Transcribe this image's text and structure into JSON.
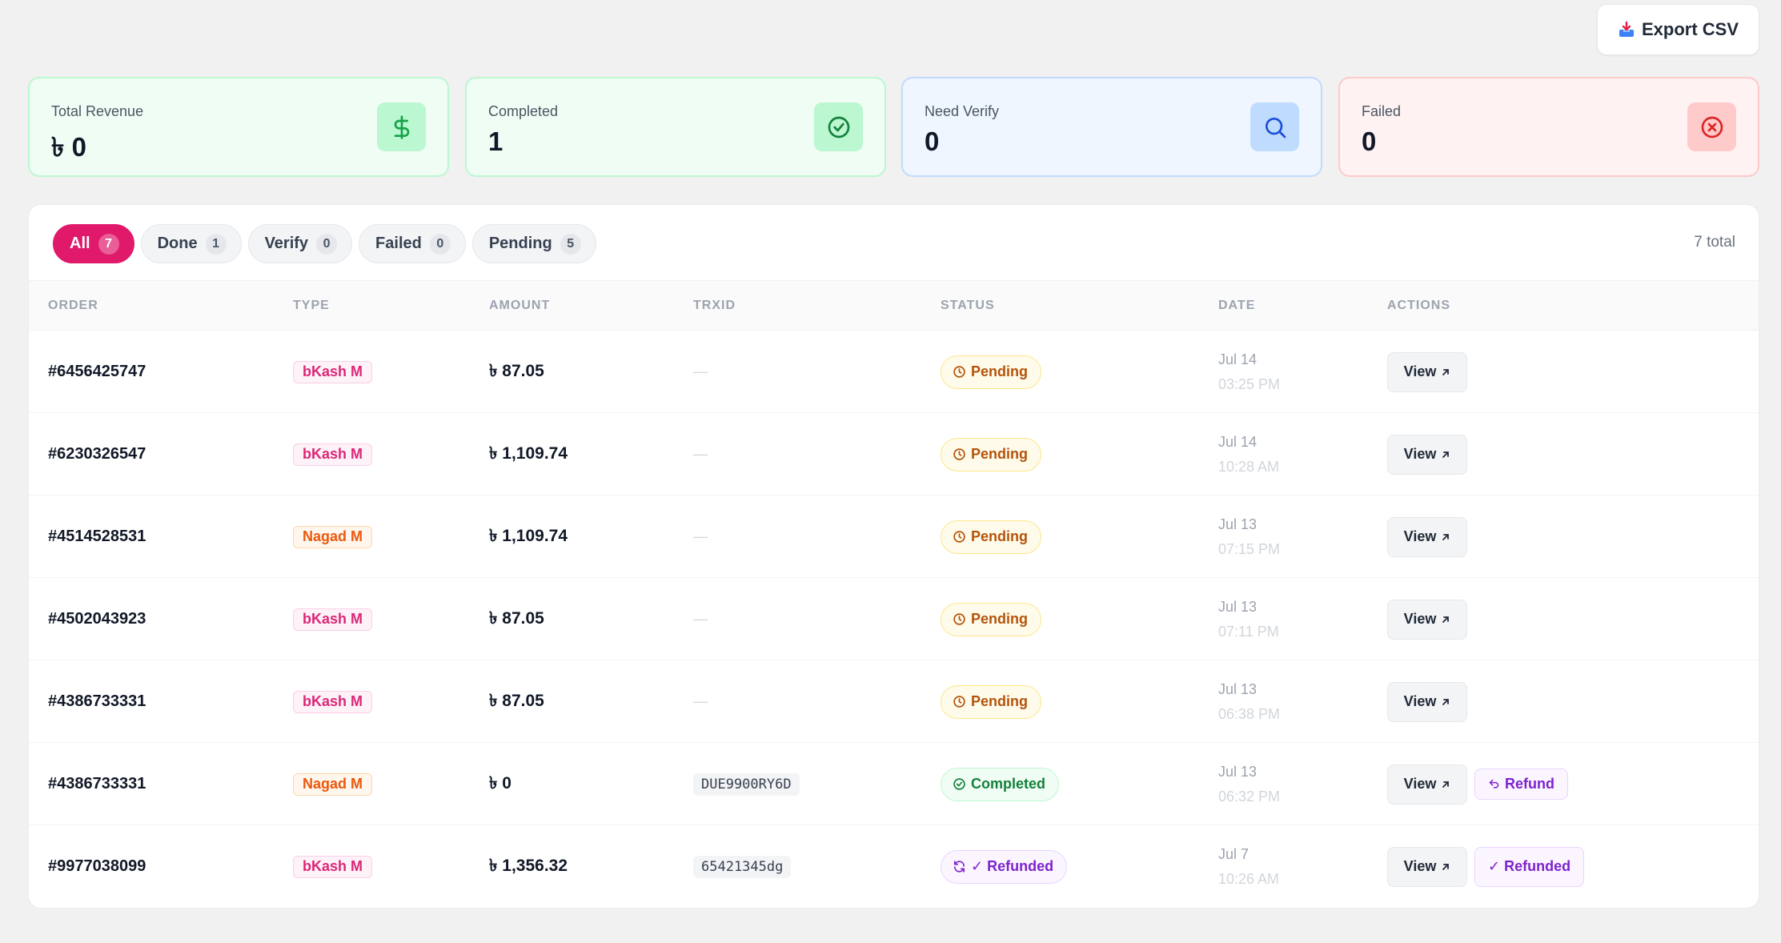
{
  "toolbar": {
    "export_label": "Export CSV"
  },
  "stats": [
    {
      "label": "Total Revenue",
      "value": "৳ 0"
    },
    {
      "label": "Completed",
      "value": "1"
    },
    {
      "label": "Need Verify",
      "value": "0"
    },
    {
      "label": "Failed",
      "value": "0"
    }
  ],
  "tabs": [
    {
      "label": "All",
      "count": "7"
    },
    {
      "label": "Done",
      "count": "1"
    },
    {
      "label": "Verify",
      "count": "0"
    },
    {
      "label": "Failed",
      "count": "0"
    },
    {
      "label": "Pending",
      "count": "5"
    }
  ],
  "total_text": "7 total",
  "columns": [
    "ORDER",
    "TYPE",
    "AMOUNT",
    "TRXID",
    "STATUS",
    "DATE",
    "ACTIONS"
  ],
  "rows": [
    {
      "order": "#6456425747",
      "type": "bKash M",
      "amount": "৳ 87.05",
      "trxid": "—",
      "status": "Pending",
      "date": "Jul 14",
      "time": "03:25 PM",
      "view": "View"
    },
    {
      "order": "#6230326547",
      "type": "bKash M",
      "amount": "৳ 1,109.74",
      "trxid": "—",
      "status": "Pending",
      "date": "Jul 14",
      "time": "10:28 AM",
      "view": "View"
    },
    {
      "order": "#4514528531",
      "type": "Nagad M",
      "amount": "৳ 1,109.74",
      "trxid": "—",
      "status": "Pending",
      "date": "Jul 13",
      "time": "07:15 PM",
      "view": "View"
    },
    {
      "order": "#4502043923",
      "type": "bKash M",
      "amount": "৳ 87.05",
      "trxid": "—",
      "status": "Pending",
      "date": "Jul 13",
      "time": "07:11 PM",
      "view": "View"
    },
    {
      "order": "#4386733331",
      "type": "bKash M",
      "amount": "৳ 87.05",
      "trxid": "—",
      "status": "Pending",
      "date": "Jul 13",
      "time": "06:38 PM",
      "view": "View"
    },
    {
      "order": "#4386733331",
      "type": "Nagad M",
      "amount": "৳ 0",
      "trxid": "DUE9900RY6D",
      "status": "Completed",
      "date": "Jul 13",
      "time": "06:32 PM",
      "view": "View",
      "refund": "Refund"
    },
    {
      "order": "#9977038099",
      "type": "bKash M",
      "amount": "৳ 1,356.32",
      "trxid": "65421345dg",
      "status": "✓ Refunded",
      "date": "Jul 7",
      "time": "10:26 AM",
      "view": "View",
      "refunded": "✓ Refunded"
    }
  ]
}
